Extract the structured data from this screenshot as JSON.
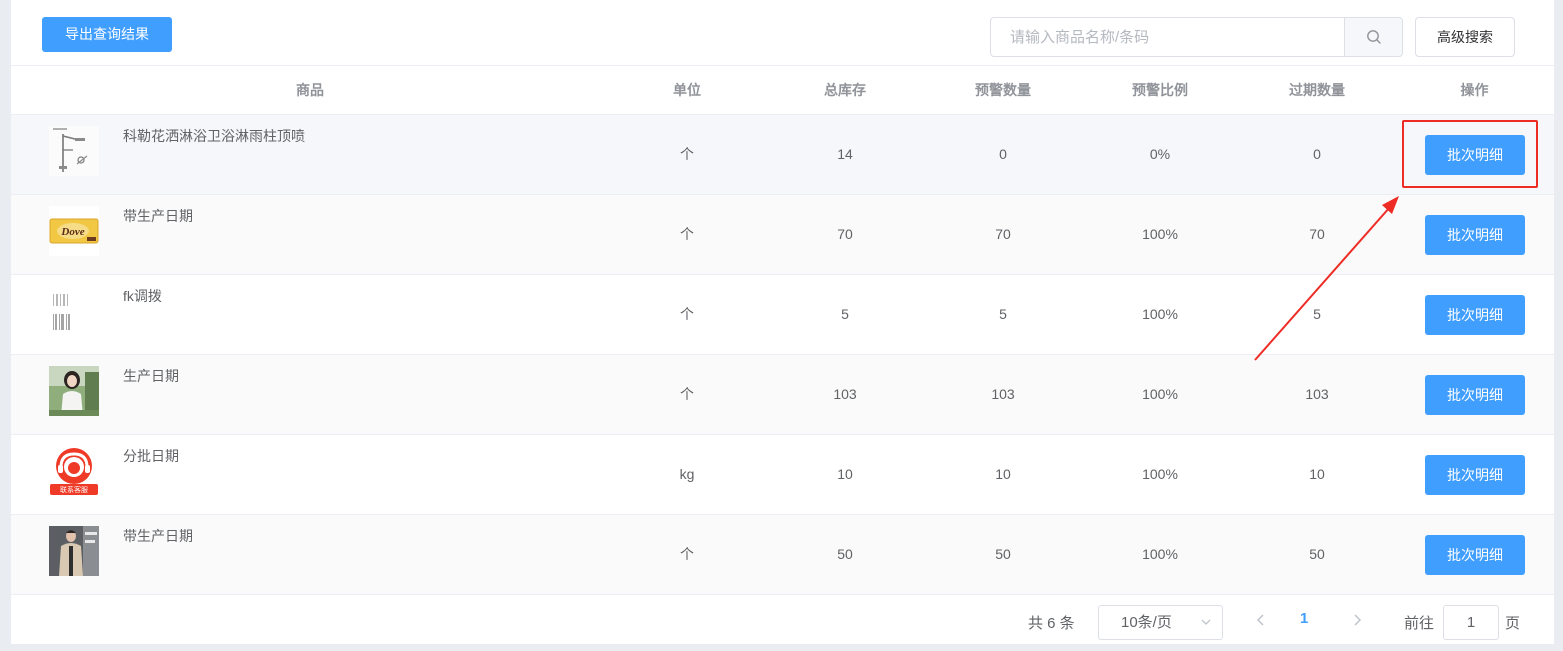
{
  "toolbar": {
    "export_label": "导出查询结果",
    "search_placeholder": "请输入商品名称/条码",
    "search_value": "",
    "advanced_label": "高级搜索"
  },
  "table": {
    "headers": {
      "product": "商品",
      "unit": "单位",
      "total_stock": "总库存",
      "warn_qty": "预警数量",
      "warn_ratio": "预警比例",
      "expired_qty": "过期数量",
      "action": "操作"
    },
    "rows": [
      {
        "name": "科勒花洒淋浴卫浴淋雨柱顶喷",
        "unit": "个",
        "total": "14",
        "warn": "0",
        "ratio": "0%",
        "expired": "0",
        "action": "批次明细",
        "thumb": "shower-image"
      },
      {
        "name": "带生产日期",
        "unit": "个",
        "total": "70",
        "warn": "70",
        "ratio": "100%",
        "expired": "70",
        "action": "批次明细",
        "thumb": "chocolate-image",
        "thumb_text": "Dove"
      },
      {
        "name": "fk调拨",
        "unit": "个",
        "total": "5",
        "warn": "5",
        "ratio": "100%",
        "expired": "5",
        "action": "批次明细",
        "thumb": "barcode-image"
      },
      {
        "name": "生产日期",
        "unit": "个",
        "total": "103",
        "warn": "103",
        "ratio": "100%",
        "expired": "103",
        "action": "批次明细",
        "thumb": "person-photo"
      },
      {
        "name": "分批日期",
        "unit": "kg",
        "total": "10",
        "warn": "10",
        "ratio": "100%",
        "expired": "10",
        "action": "批次明细",
        "thumb": "customer-service-logo",
        "thumb_text": "联系客服"
      },
      {
        "name": "带生产日期",
        "unit": "个",
        "total": "50",
        "warn": "50",
        "ratio": "100%",
        "expired": "50",
        "action": "批次明细",
        "thumb": "clothing-photo"
      }
    ]
  },
  "pagination": {
    "total_text": "共 6 条",
    "page_size": "10条/页",
    "current_page": "1",
    "goto_label": "前往",
    "goto_value": "1",
    "page_unit": "页"
  },
  "colors": {
    "primary": "#409eff",
    "annotation": "#ee2b24"
  }
}
